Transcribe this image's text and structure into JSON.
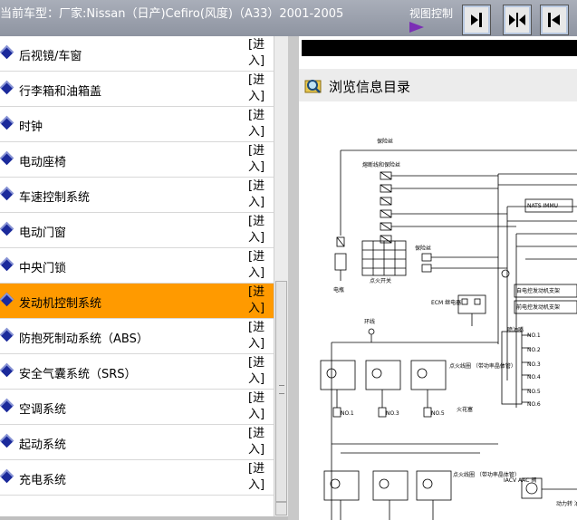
{
  "header": {
    "vehicle_info": "当前车型：厂家:Nissan（日产)Cefiro(风度)（A33）2001-2005",
    "view_control": "视图控制"
  },
  "icons": {
    "play": "play-triangle-icon",
    "buttons": [
      "collapse-left-icon",
      "split-view-icon",
      "collapse-right-icon"
    ],
    "list_item": "blue-diamond-icon",
    "browse": "magnifier-folder-icon"
  },
  "colors": {
    "selected": "#ff9a00",
    "diamond": "#1b2a9b",
    "accent": "#7b2fb5"
  },
  "sidebar": {
    "items": [
      {
        "label": "后视镜/车窗",
        "enter": "[进入]"
      },
      {
        "label": "行李箱和油箱盖",
        "enter": "[进入]"
      },
      {
        "label": "时钟",
        "enter": "[进入]"
      },
      {
        "label": "电动座椅",
        "enter": "[进入]"
      },
      {
        "label": "车速控制系统",
        "enter": "[进入]"
      },
      {
        "label": "电动门窗",
        "enter": "[进入]"
      },
      {
        "label": "中央门锁",
        "enter": "[进入]"
      },
      {
        "label": "发动机控制系统",
        "enter": "[进入]",
        "selected": true
      },
      {
        "label": "防抱死制动系统（ABS）",
        "enter": "[进入]"
      },
      {
        "label": "安全气囊系统（SRS）",
        "enter": "[进入]"
      },
      {
        "label": "空调系统",
        "enter": "[进入]"
      },
      {
        "label": "起动系统",
        "enter": "[进入]"
      },
      {
        "label": "充电系统",
        "enter": "[进入]"
      }
    ]
  },
  "main": {
    "title": "浏览信息目录",
    "diagram": {
      "fuse": "保险丝",
      "fusible_link": "熔断线和保险丝",
      "nats": "NATS IMMU",
      "ignition_switch": "点火开关",
      "battery": "电瓶",
      "fuse2": "保险丝",
      "ecm_relay": "ECM\n继电器",
      "ring": "环线",
      "engine_mount1": "自电控发动机支架",
      "engine_mount2": "前电控发动机支架",
      "ignition_coil": "点火线圈\n（带功率晶体管）",
      "spark_plug": "火花塞",
      "ignition_coil2": "点火线圈\n（带功率晶体管）",
      "injectors": "喷油嘴",
      "iacv": "IACV\nAAC\n阀",
      "power_steering": "动力转\n油压开",
      "no_labels": [
        "NO.1",
        "NO.2",
        "NO.3",
        "NO.4",
        "NO.5",
        "NO.6"
      ],
      "plug_labels": [
        "NO.1",
        "NO.3",
        "NO.5"
      ]
    }
  }
}
